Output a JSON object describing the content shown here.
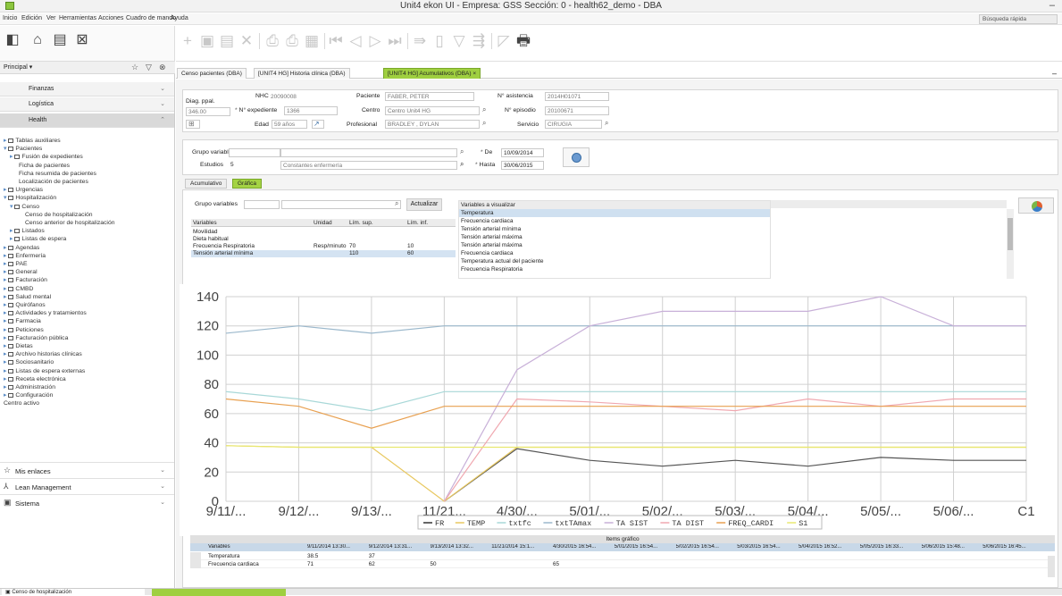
{
  "window": {
    "title": "Unit4 ekon UI - Empresa: GSS Sección: 0 - health62_demo - DBA",
    "minimize": "–"
  },
  "menu": {
    "items": [
      "Inicio",
      "Edición",
      "Ver",
      "Herramientas",
      "Acciones",
      "Cuadro de mando",
      "Ayuda"
    ],
    "quick_search": "Búsqueda rápida"
  },
  "sidebar": {
    "header": "Principal ▾",
    "modules": [
      {
        "label": "Finanzas"
      },
      {
        "label": "Logística"
      },
      {
        "label": "Health"
      }
    ],
    "tree": [
      {
        "label": "Tablas auxiliares",
        "level": 0,
        "icon": "folder"
      },
      {
        "label": "Pacientes",
        "level": 0,
        "icon": "folder-open"
      },
      {
        "label": "Fusión de expedientes",
        "level": 1,
        "icon": "folder"
      },
      {
        "label": "Ficha de pacientes",
        "level": 1,
        "icon": "none"
      },
      {
        "label": "Ficha resumida de pacientes",
        "level": 1,
        "icon": "none"
      },
      {
        "label": "Localización de pacientes",
        "level": 1,
        "icon": "none"
      },
      {
        "label": "Urgencias",
        "level": 0,
        "icon": "folder"
      },
      {
        "label": "Hospitalización",
        "level": 0,
        "icon": "folder-open"
      },
      {
        "label": "Censo",
        "level": 1,
        "icon": "folder-open"
      },
      {
        "label": "Censo de hospitalización",
        "level": 2,
        "icon": "none"
      },
      {
        "label": "Censo anterior de hospitalización",
        "level": 2,
        "icon": "none"
      },
      {
        "label": "Listados",
        "level": 1,
        "icon": "folder"
      },
      {
        "label": "Listas de espera",
        "level": 1,
        "icon": "folder"
      },
      {
        "label": "Agendas",
        "level": 0,
        "icon": "folder"
      },
      {
        "label": "Enfermería",
        "level": 0,
        "icon": "folder"
      },
      {
        "label": "PAE",
        "level": 0,
        "icon": "folder"
      },
      {
        "label": "General",
        "level": 0,
        "icon": "folder"
      },
      {
        "label": "Facturación",
        "level": 0,
        "icon": "folder"
      },
      {
        "label": "CMBD",
        "level": 0,
        "icon": "folder"
      },
      {
        "label": "Salud mental",
        "level": 0,
        "icon": "folder"
      },
      {
        "label": "Quirófanos",
        "level": 0,
        "icon": "folder"
      },
      {
        "label": "Actividades y tratamientos",
        "level": 0,
        "icon": "folder"
      },
      {
        "label": "Farmacia",
        "level": 0,
        "icon": "folder"
      },
      {
        "label": "Peticiones",
        "level": 0,
        "icon": "folder"
      },
      {
        "label": "Facturación pública",
        "level": 0,
        "icon": "folder"
      },
      {
        "label": "Dietas",
        "level": 0,
        "icon": "folder"
      },
      {
        "label": "Archivo historias clínicas",
        "level": 0,
        "icon": "folder"
      },
      {
        "label": "Sociosanitario",
        "level": 0,
        "icon": "folder"
      },
      {
        "label": "Listas de espera externas",
        "level": 0,
        "icon": "folder"
      },
      {
        "label": "Receta electrónica",
        "level": 0,
        "icon": "folder"
      },
      {
        "label": "Administración",
        "level": 0,
        "icon": "folder"
      },
      {
        "label": "Configuración",
        "level": 0,
        "icon": "folder"
      },
      {
        "label": "Centro activo",
        "level": -1,
        "icon": "none"
      }
    ],
    "bottom_modules": [
      {
        "label": "Mis enlaces",
        "icon": "☆"
      },
      {
        "label": "Lean Management",
        "icon": "⅄"
      },
      {
        "label": "Sistema",
        "icon": "🖥"
      }
    ]
  },
  "tabs": [
    {
      "label": "Censo pacientes (DBA)"
    },
    {
      "label": "[UNIT4 HG] Historia clínica (DBA)"
    },
    {
      "label": "[UNIT4 HG] Acumulativos (DBA)",
      "close": "×"
    }
  ],
  "patient": {
    "diag_label": "Diag. ppal.",
    "diag_value": "346.00",
    "nhc_label": "NHC",
    "nhc_value": "20090008",
    "exp_label": "N° expediente",
    "exp_value": "1366",
    "edad_label": "Edad",
    "edad_value": "59 años",
    "paciente_label": "Paciente",
    "paciente_value": "FABER, PETER",
    "centro_label": "Centro",
    "centro_value": "Centro Unit4 HG",
    "prof_label": "Profesional",
    "prof_value": "BRADLEY , DYLAN",
    "asist_label": "N° asistencia",
    "asist_value": "2014H01071",
    "episodio_label": "N° episodio",
    "episodio_value": "20100671",
    "servicio_label": "Servicio",
    "servicio_value": "CIRUGIA"
  },
  "filters": {
    "grupo_label": "Grupo variables",
    "estudios_label": "Estudios",
    "estudios_value": "5",
    "estudios_desc": "Constantes enfermería",
    "de_label": "De",
    "de_value": "10/09/2014",
    "hasta_label": "Hasta",
    "hasta_value": "30/06/2015"
  },
  "subtabs": [
    "Acumulativo",
    "Gráfica"
  ],
  "vargrid": {
    "grupo_label": "Grupo variables",
    "actualizar": "Actualizar",
    "headers": [
      "Variables",
      "Unidad",
      "Lím. sup.",
      "Lím. inf."
    ],
    "rows": [
      [
        "Movilidad",
        "",
        "",
        ""
      ],
      [
        "Dieta habitual",
        "",
        "",
        ""
      ],
      [
        "Frecuencia Respiratoria",
        "Resp/minuto",
        "70",
        "10"
      ],
      [
        "Tensión arterial mínima",
        "",
        "110",
        "60"
      ]
    ]
  },
  "visualizar": {
    "header": "Variables a visualizar",
    "items": [
      "Temperatura",
      "Frecuencia cardiaca",
      "Tensión arterial mínima",
      "Tensión arterial máxima",
      "Tensión arterial máxima",
      "Frecuencia cardiaca",
      "Temperatura actual del paciente",
      "Frecuencia Respiratoria"
    ]
  },
  "chart_data": {
    "type": "line",
    "categories": [
      "9/11/...",
      "9/12/...",
      "9/13/...",
      "11/21...",
      "4/30/...",
      "5/01/...",
      "5/02/...",
      "5/03/...",
      "5/04/...",
      "5/05/...",
      "5/06/...",
      "C1"
    ],
    "ylim": [
      0,
      140
    ],
    "yticks": [
      0,
      20,
      40,
      60,
      80,
      100,
      120,
      140
    ],
    "grid": true,
    "legend_position": "bottom",
    "series": [
      {
        "name": "FR",
        "color": "#555555",
        "values": [
          null,
          null,
          null,
          0,
          36,
          28,
          24,
          28,
          24,
          30,
          28,
          28
        ]
      },
      {
        "name": "TEMP",
        "color": "#e8c860",
        "values": [
          38,
          37,
          37,
          0,
          37,
          37,
          37,
          37,
          37,
          37,
          37,
          37
        ]
      },
      {
        "name": "txtfc",
        "color": "#a8d8d8",
        "values": [
          75,
          70,
          62,
          75,
          75,
          75,
          75,
          75,
          75,
          75,
          75,
          75
        ]
      },
      {
        "name": "txtTAmax",
        "color": "#9bb8cc",
        "values": [
          115,
          120,
          115,
          120,
          120,
          120,
          120,
          120,
          120,
          120,
          120,
          120
        ]
      },
      {
        "name": "TA SIST",
        "color": "#c8b0d8",
        "values": [
          null,
          null,
          null,
          0,
          90,
          120,
          130,
          130,
          130,
          140,
          120,
          120
        ]
      },
      {
        "name": "TA DIST",
        "color": "#f0a8b0",
        "values": [
          null,
          null,
          null,
          0,
          70,
          68,
          65,
          62,
          70,
          65,
          70,
          70
        ]
      },
      {
        "name": "FREQ_CARDI",
        "color": "#e8a050",
        "values": [
          70,
          65,
          50,
          65,
          65,
          65,
          65,
          65,
          65,
          65,
          65,
          65
        ]
      },
      {
        "name": "S1",
        "color": "#e8e870",
        "values": [
          38,
          37,
          37,
          37,
          37,
          37,
          37,
          37,
          37,
          37,
          37,
          37
        ]
      }
    ]
  },
  "items_grid": {
    "title": "Items gráfico",
    "headers": [
      "Variables",
      "9/11/2014 13:30...",
      "9/12/2014 13:31...",
      "9/13/2014 13:32...",
      "11/21/2014 15:1...",
      "4/30/2015 16:54...",
      "5/01/2015 16:54...",
      "5/02/2015 16:54...",
      "5/03/2015 16:54...",
      "5/04/2015 16:52...",
      "5/05/2015 16:33...",
      "5/06/2015 15:48...",
      "5/06/2015 16:45..."
    ],
    "rows": [
      [
        "Temperatura",
        "38.5",
        "37",
        "",
        "",
        "",
        "",
        "",
        "",
        "",
        "",
        "",
        ""
      ],
      [
        "Frecuencia cardiaca",
        "71",
        "62",
        "50",
        "",
        "65",
        "",
        "",
        "",
        "",
        "",
        "",
        ""
      ]
    ]
  },
  "bottom_tabs": [
    "Censo de hospitalización"
  ]
}
